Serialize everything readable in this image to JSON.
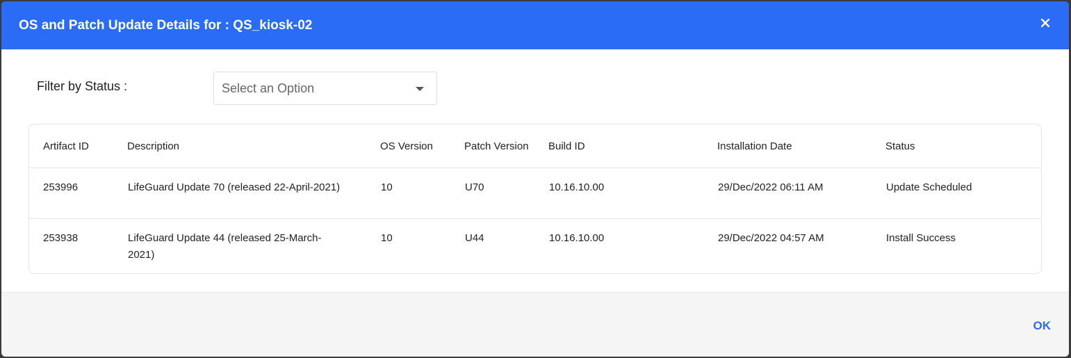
{
  "dialog": {
    "title": "OS and Patch Update Details for : QS_kiosk-02",
    "close_icon": "close-icon",
    "ok_label": "OK"
  },
  "filter": {
    "label": "Filter by Status :",
    "placeholder": "Select an Option",
    "dropdown_icon": "chevron-down-icon"
  },
  "table": {
    "headers": [
      "Artifact ID",
      "Description",
      "OS Version",
      "Patch Version",
      "Build ID",
      "Installation Date",
      "Status"
    ],
    "rows": [
      {
        "artifact_id": "253996",
        "description": "LifeGuard Update 70 (released 22-April-2021)",
        "os_version": "10",
        "patch_version": "U70",
        "build_id": "10.16.10.00",
        "installation_date": "29/Dec/2022 06:11 AM",
        "status": "Update Scheduled"
      },
      {
        "artifact_id": "253938",
        "description": "LifeGuard Update 44 (released 25-March-2021)",
        "os_version": "10",
        "patch_version": "U44",
        "build_id": "10.16.10.00",
        "installation_date": "29/Dec/2022 04:57 AM",
        "status": "Install Success"
      }
    ]
  },
  "colors": {
    "header_bg": "#2a6cf6",
    "accent": "#2a6cf6"
  }
}
